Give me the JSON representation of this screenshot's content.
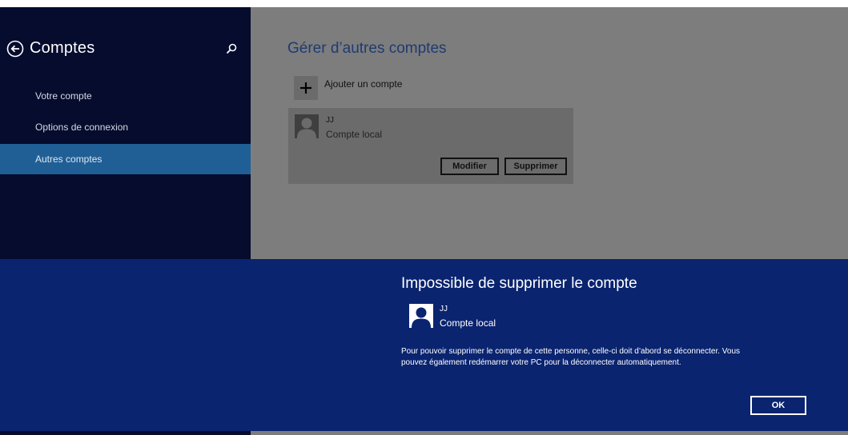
{
  "sidebar": {
    "title": "Comptes",
    "items": [
      {
        "label": "Votre compte"
      },
      {
        "label": "Options de connexion"
      },
      {
        "label": "Autres comptes",
        "selected": true
      }
    ]
  },
  "content": {
    "title": "Gérer d’autres comptes",
    "add_account_label": "Ajouter un compte",
    "account": {
      "name": "JJ",
      "type": "Compte local",
      "modify_label": "Modifier",
      "delete_label": "Supprimer"
    }
  },
  "dialog": {
    "title": "Impossible de supprimer le compte",
    "account_name": "JJ",
    "account_type": "Compte local",
    "message_line1": "Pour pouvoir supprimer le compte de cette personne, celle-ci doit d’abord se déconnecter. Vous",
    "message_line2": "pouvez également redémarrer votre PC pour la déconnecter automatiquement.",
    "ok_label": "OK"
  },
  "colors": {
    "sidebar_bg": "#050c2e",
    "selected_item": "#205f95",
    "content_bg_dimmed": "#7d7d7d",
    "dialog_bg": "#0a2470",
    "title_accent": "#1e3b72"
  },
  "icons": [
    "back-arrow-icon",
    "search-icon",
    "plus-icon",
    "user-avatar-icon"
  ]
}
